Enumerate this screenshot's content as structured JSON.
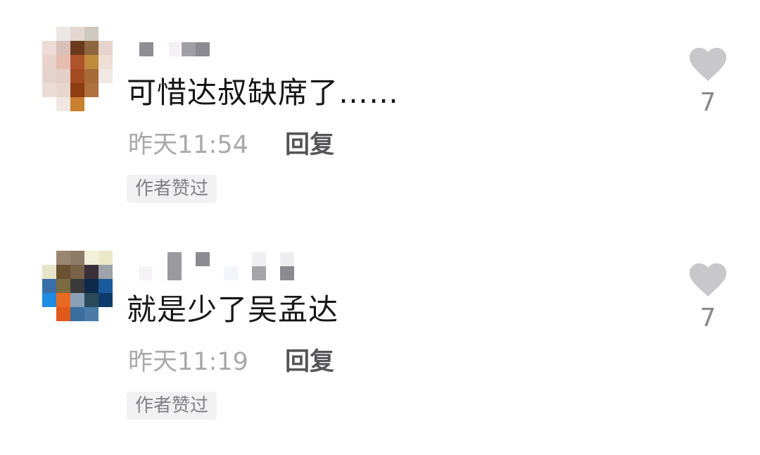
{
  "comments": [
    {
      "username": "",
      "text": "可惜达叔缺席了……",
      "time": "昨天11:54",
      "reply_label": "回复",
      "badge": "作者赞过",
      "likes": "7",
      "icons": {
        "like": "heart-icon"
      }
    },
    {
      "username": "",
      "text": "就是少了吴孟达",
      "time": "昨天11:19",
      "reply_label": "回复",
      "badge": "作者赞过",
      "likes": "7",
      "icons": {
        "like": "heart-icon"
      }
    }
  ],
  "colors": {
    "text": "#161616",
    "time": "#a9a9ab",
    "reply": "#555557",
    "badge_bg": "#f1f1f2",
    "badge_text": "#808084",
    "heart": "#c8c8ca",
    "like_count": "#8a8a8c"
  }
}
